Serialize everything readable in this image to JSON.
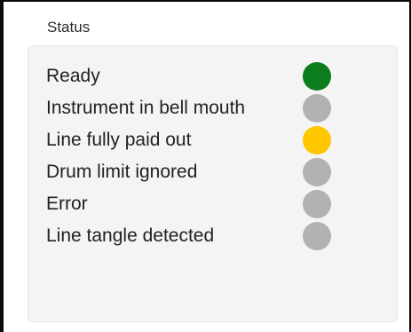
{
  "group": {
    "title": "Status"
  },
  "colors": {
    "green": "#0b7d1c",
    "yellow": "#ffc700",
    "gray": "#b2b2b2"
  },
  "statuses": [
    {
      "label": "Ready",
      "state": "green"
    },
    {
      "label": "Instrument in bell mouth",
      "state": "gray"
    },
    {
      "label": "Line fully paid out",
      "state": "yellow"
    },
    {
      "label": "Drum limit ignored",
      "state": "gray"
    },
    {
      "label": "Error",
      "state": "gray"
    },
    {
      "label": "Line tangle detected",
      "state": "gray"
    }
  ]
}
